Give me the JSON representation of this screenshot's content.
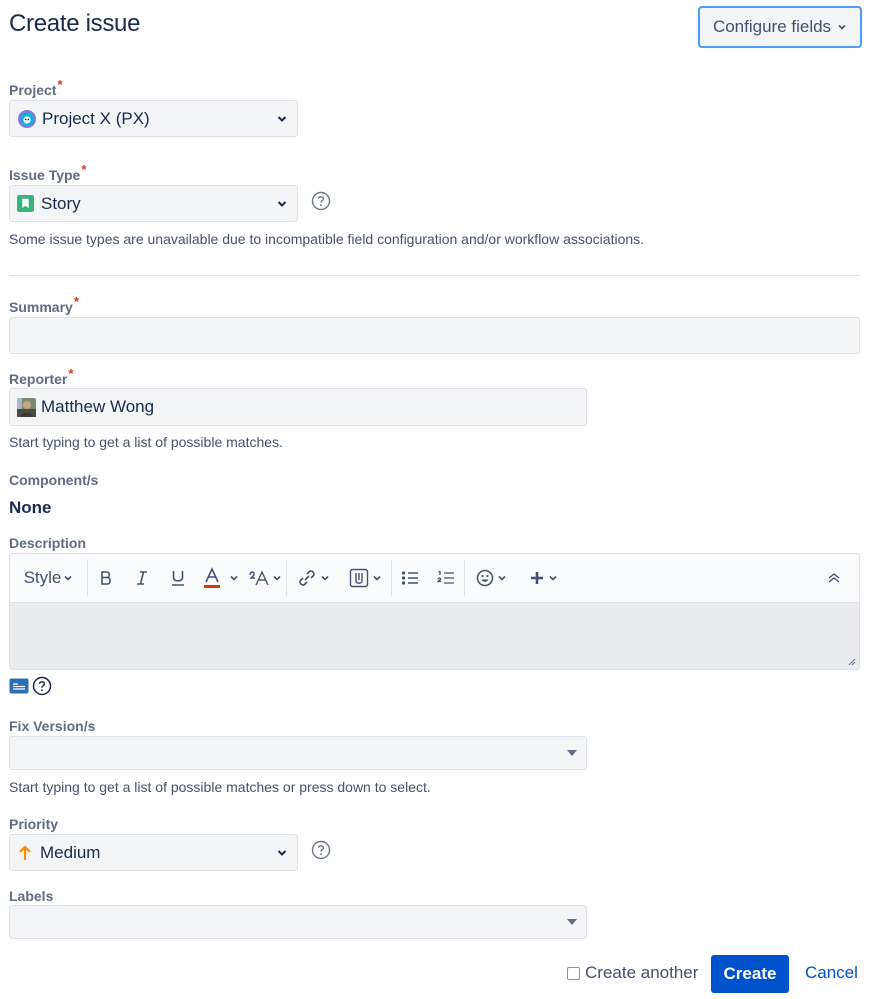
{
  "dialog": {
    "title": "Create issue",
    "configure_fields_label": "Configure fields"
  },
  "fields": {
    "project": {
      "label": "Project",
      "required_marker": "*",
      "value": "Project X (PX)",
      "icon": "project-avatar-icon"
    },
    "issue_type": {
      "label": "Issue Type",
      "required_marker": "*",
      "value": "Story",
      "icon": "story-icon",
      "hint": "Some issue types are unavailable due to incompatible field configuration and/or workflow associations."
    },
    "summary": {
      "label": "Summary",
      "required_marker": "*",
      "value": ""
    },
    "reporter": {
      "label": "Reporter",
      "required_marker": "*",
      "value": "Matthew Wong",
      "icon": "user-avatar",
      "hint": "Start typing to get a list of possible matches."
    },
    "component": {
      "label": "Component/s",
      "value": "None"
    },
    "description": {
      "label": "Description",
      "toolbar": {
        "style_label": "Style"
      },
      "value": ""
    },
    "fix_version": {
      "label": "Fix Version/s",
      "value": "",
      "hint": "Start typing to get a list of possible matches or press down to select."
    },
    "priority": {
      "label": "Priority",
      "value": "Medium",
      "icon": "arrow-up-icon"
    },
    "labels": {
      "label": "Labels",
      "value": ""
    }
  },
  "footer": {
    "create_another_label": "Create another",
    "create_another_checked": false,
    "create_label": "Create",
    "cancel_label": "Cancel"
  },
  "colors": {
    "primary": "#0052cc",
    "required": "#de350b",
    "focus_ring": "#4c9aff",
    "story_green": "#36b37e",
    "priority_medium": "#ff8b00"
  }
}
